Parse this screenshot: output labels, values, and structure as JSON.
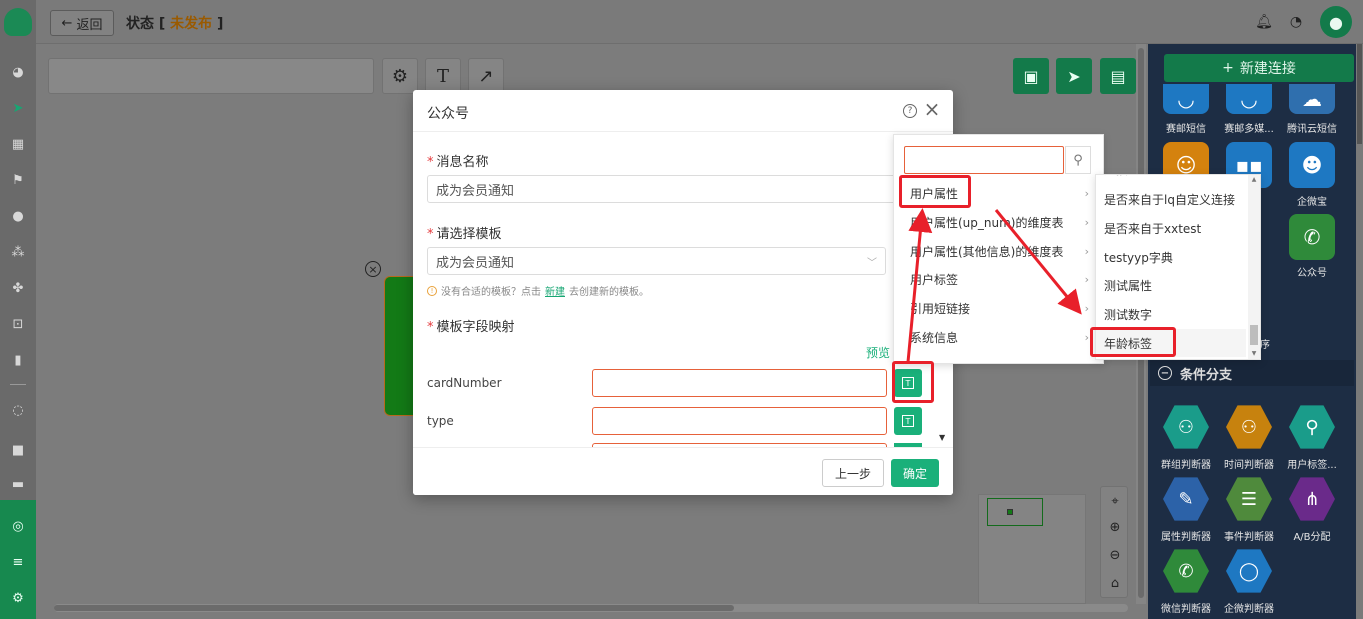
{
  "topbar": {
    "back_label": "返回",
    "status_prefix": "状态 [",
    "status_tag": "未发布",
    "status_suffix": "]"
  },
  "canvas": {
    "tools": [
      "gear-icon",
      "text-icon",
      "arrow-icon"
    ],
    "right_tools": [
      "save-icon",
      "send-icon",
      "layout-icon"
    ]
  },
  "right_panel": {
    "new_connection": "新建连接",
    "row1": [
      "赛邮短信",
      "赛邮多媒...",
      "腾讯云短信"
    ],
    "row2": [
      "企微宝"
    ],
    "row3": [
      "公众号"
    ],
    "row4_partial": "序",
    "section_title": "条件分支",
    "cond_row1": [
      "群组判断器",
      "时间判断器",
      "用户标签..."
    ],
    "cond_row2": [
      "属性判断器",
      "事件判断器",
      "A/B分配"
    ],
    "cond_row3": [
      "微信判断器",
      "企微判断器"
    ]
  },
  "modal": {
    "title": "公众号",
    "msg_name_label": "消息名称",
    "msg_name_value": "成为会员通知",
    "template_label": "请选择模板",
    "template_value": "成为会员通知",
    "hint_prefix": "没有合适的模板？点击",
    "hint_link": "新建",
    "hint_suffix": "去创建新的模板。",
    "mapping_label": "模板字段映射",
    "preview": "预览",
    "fields": [
      "cardNumber",
      "type"
    ],
    "btn_prev": "上一步",
    "btn_ok": "确定",
    "tbtn_glyph": "T"
  },
  "cascader": {
    "level1": [
      "用户属性",
      "用户属性(up_num)的维度表",
      "用户属性(其他信息)的维度表",
      "用户标签",
      "引用短链接",
      "系统信息"
    ],
    "level2_partial_top": "连接",
    "level2": [
      "是否来自于lq自定义连接",
      "是否来自于xxtest",
      "testyyp字典",
      "测试属性",
      "测试数字",
      "年龄标签"
    ]
  },
  "colors": {
    "brand_green": "#1ab07a",
    "annotation_red": "#e8202a",
    "status_orange": "#9a5a00"
  }
}
